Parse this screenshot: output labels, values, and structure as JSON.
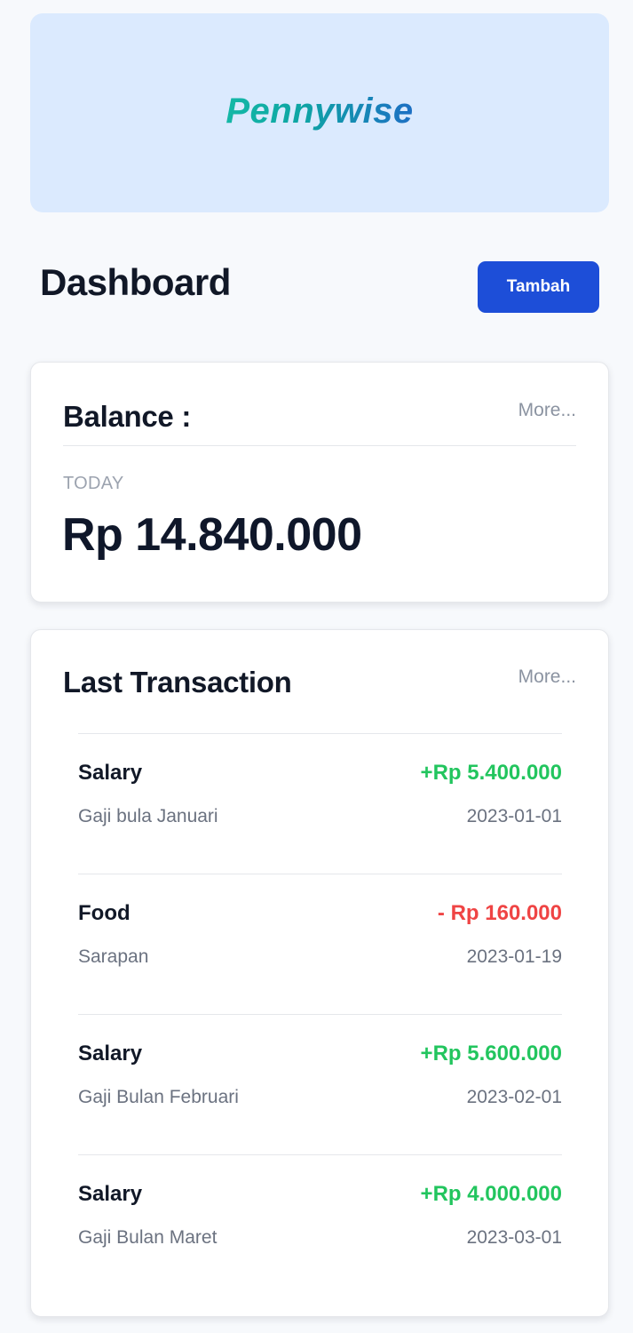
{
  "brand": {
    "logo_text": "Pennywise"
  },
  "header": {
    "title": "Dashboard",
    "add_button_label": "Tambah"
  },
  "balance": {
    "title": "Balance :",
    "more_label": "More...",
    "period_label": "TODAY",
    "amount": "Rp 14.840.000"
  },
  "transactions": {
    "title": "Last Transaction",
    "more_label": "More...",
    "items": [
      {
        "category": "Salary",
        "amount": "+Rp 5.400.000",
        "type": "income",
        "note": "Gaji bula Januari",
        "date": "2023-01-01"
      },
      {
        "category": "Food",
        "amount": "- Rp 160.000",
        "type": "expense",
        "note": "Sarapan",
        "date": "2023-01-19"
      },
      {
        "category": "Salary",
        "amount": "+Rp 5.600.000",
        "type": "income",
        "note": "Gaji Bulan Februari",
        "date": "2023-02-01"
      },
      {
        "category": "Salary",
        "amount": "+Rp 4.000.000",
        "type": "income",
        "note": "Gaji Bulan Maret",
        "date": "2023-03-01"
      }
    ]
  },
  "colors": {
    "primary": "#1d4ed8",
    "hero_bg": "#dbeafe",
    "income": "#22c55e",
    "expense": "#ef4444",
    "muted": "#6b7280"
  }
}
